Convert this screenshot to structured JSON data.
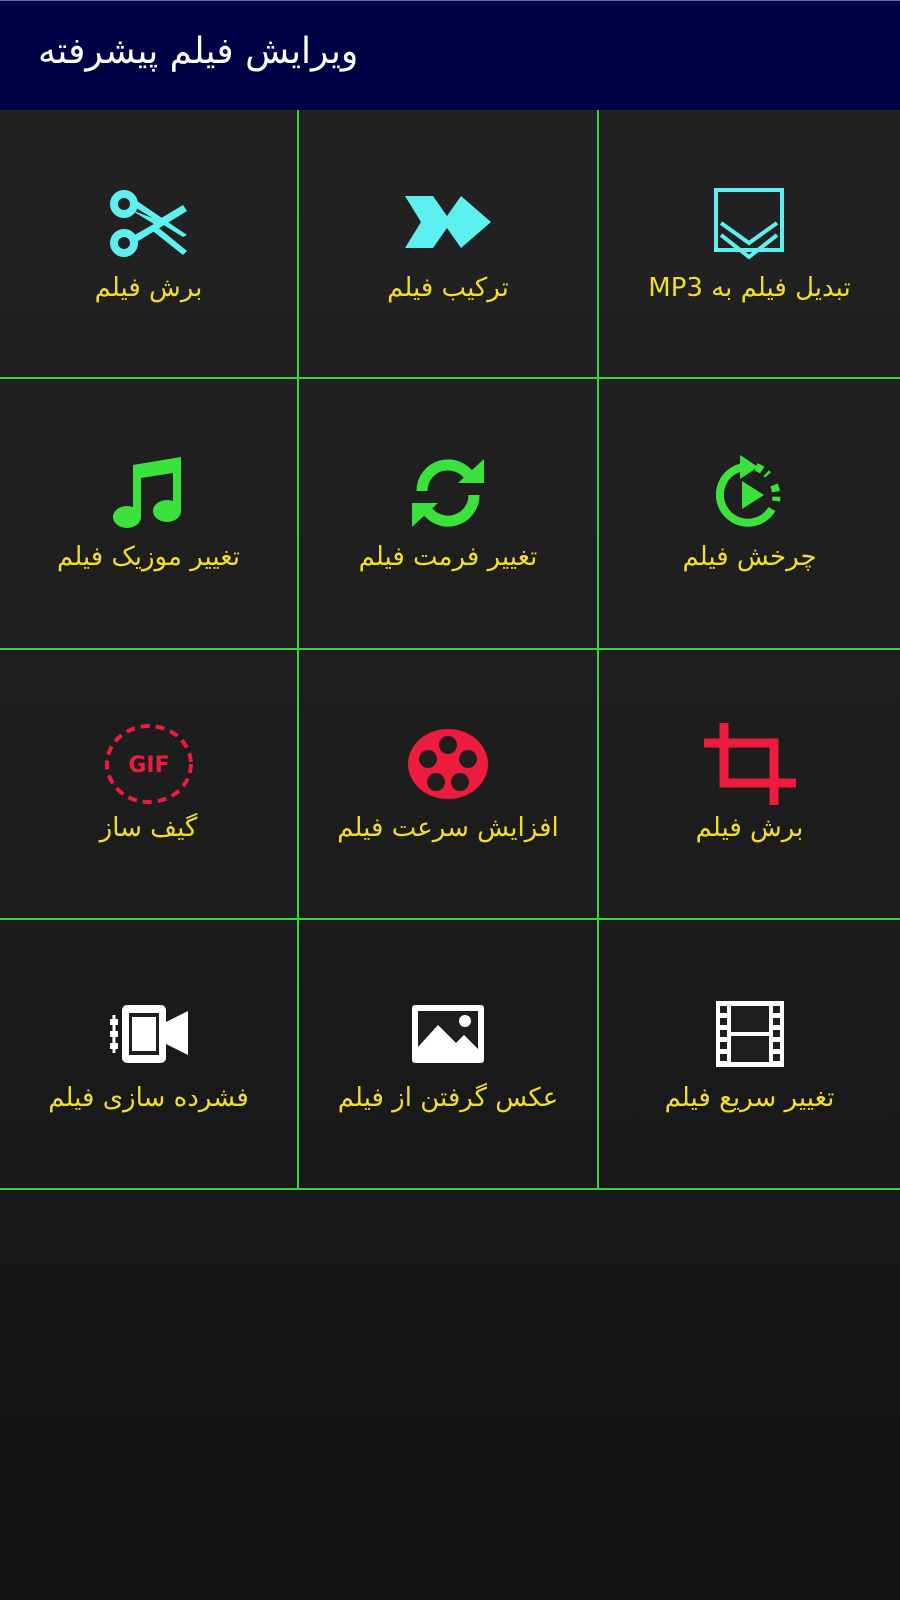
{
  "app_bar": {
    "title": "ویرایش فیلم پیشرفته",
    "background": "#000046"
  },
  "colors": {
    "grid_lines": "#3ed23e",
    "label": "#f2dd2c",
    "cyan": "#5ef0f0",
    "green": "#3ce23c",
    "red": "#ee1c3c",
    "white": "#ffffff"
  },
  "tools": [
    {
      "label": "برش فیلم",
      "icon": "scissors-icon"
    },
    {
      "label": "ترکیب فیلم",
      "icon": "fast-forward-arrow-icon"
    },
    {
      "label": "تبدیل فیلم به MP3",
      "icon": "download-chevron-icon"
    },
    {
      "label": "تغییر موزیک فیلم",
      "icon": "music-note-icon"
    },
    {
      "label": "تغییر فرمت فیلم",
      "icon": "sync-arrows-icon"
    },
    {
      "label": "چرخش فیلم",
      "icon": "rotate-play-icon"
    },
    {
      "label": "گیف ساز",
      "icon": "gif-badge-icon",
      "icon_text": "GIF"
    },
    {
      "label": "افزایش سرعت فیلم",
      "icon": "film-reel-icon"
    },
    {
      "label": "برش فیلم",
      "icon": "crop-icon"
    },
    {
      "label": "فشرده سازی فیلم",
      "icon": "video-compress-icon"
    },
    {
      "label": "عکس گرفتن از فیلم",
      "icon": "image-icon"
    },
    {
      "label": "تغییر سریع فیلم",
      "icon": "film-strip-icon"
    }
  ]
}
